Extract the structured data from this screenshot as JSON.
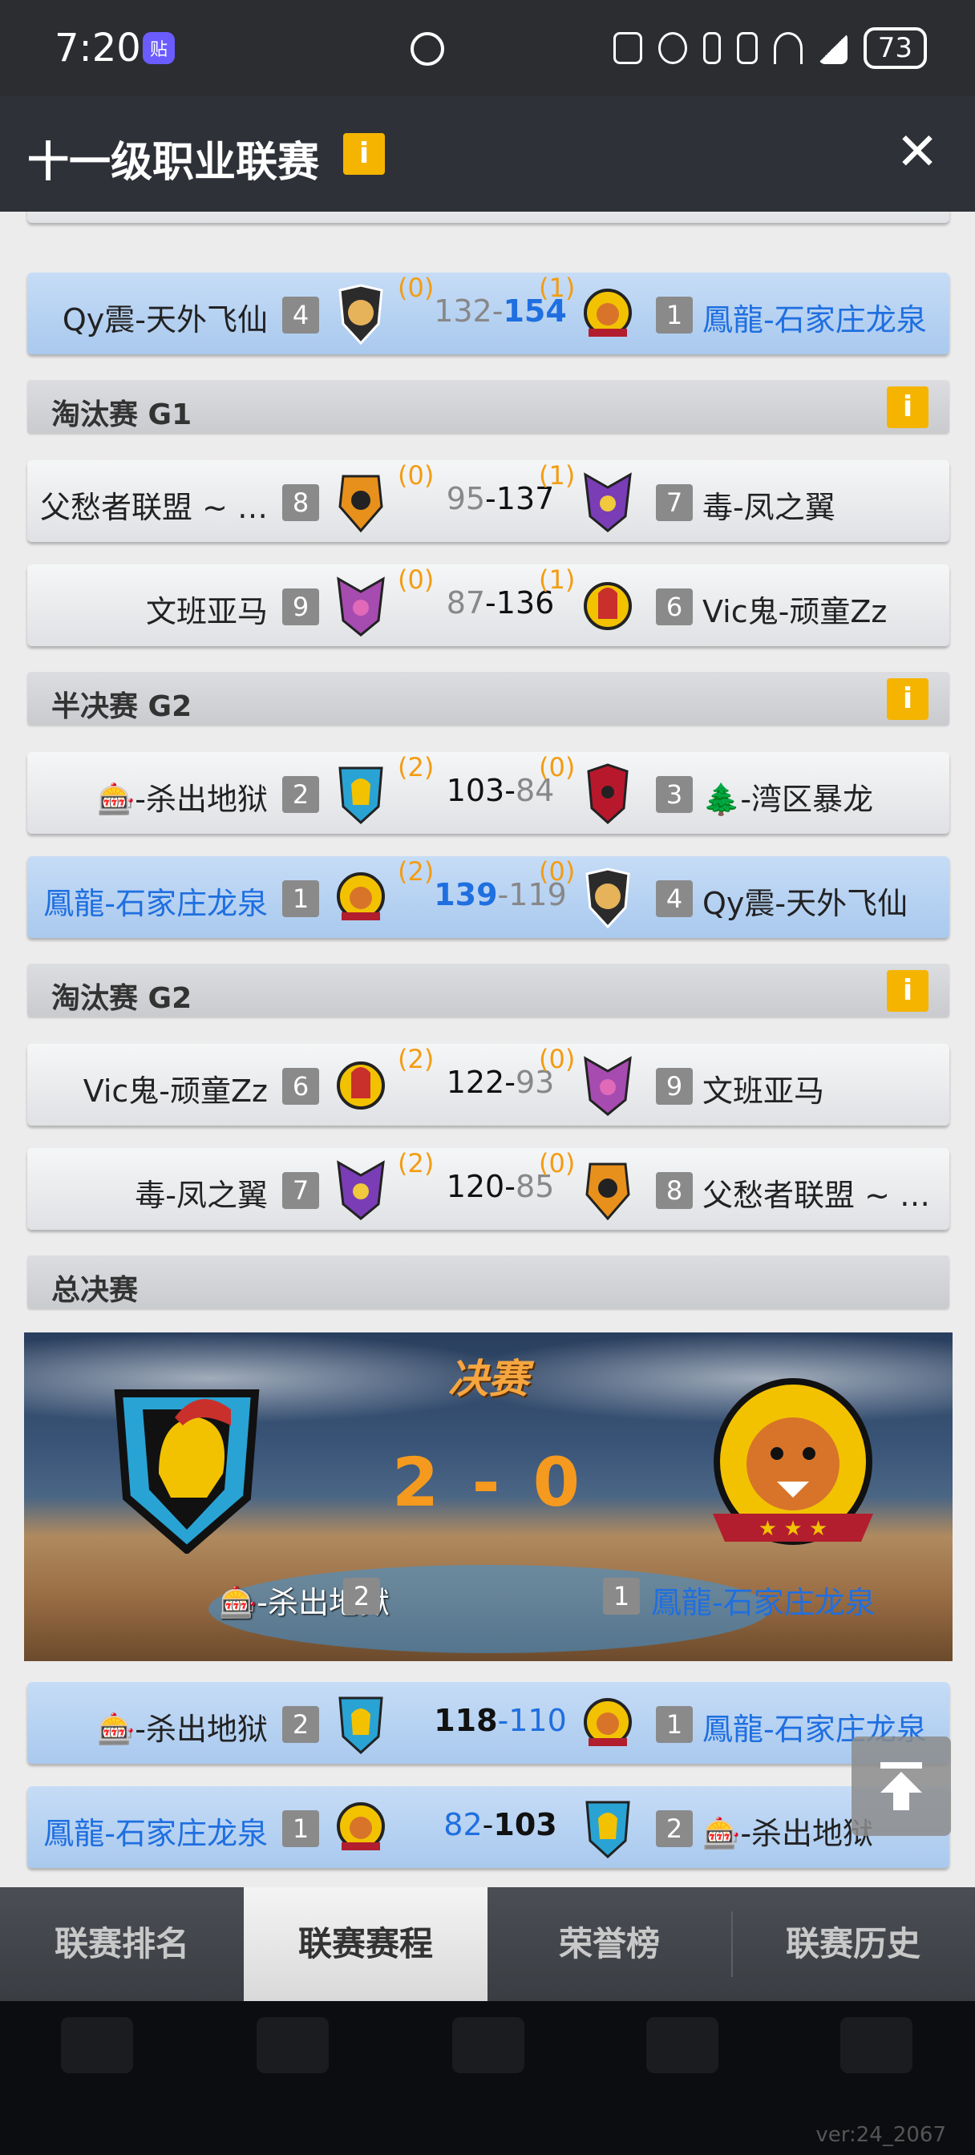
{
  "status_bar": {
    "time": "7:20",
    "app_icon": "贴",
    "battery": "73"
  },
  "header": {
    "title": "十一级职业联赛",
    "info_label": "i",
    "close_label": "✕"
  },
  "sections": {
    "elim_g1": "淘汰赛 G1",
    "semi_g2": "半决赛 G2",
    "elim_g2": "淘汰赛 G2",
    "grand_final": "总决赛",
    "info_label": "i"
  },
  "matches": [
    {
      "left_team": "Qy震-天外飞仙",
      "left_seed": "4",
      "left_series": "(0)",
      "left_score": "132",
      "right_score": "154",
      "right_series": "(1)",
      "right_seed": "1",
      "right_team": "鳳龍-石家庄龙泉"
    },
    {
      "left_team": "父愁者联盟 ~ …",
      "left_seed": "8",
      "left_series": "(0)",
      "left_score": "95",
      "right_score": "137",
      "right_series": "(1)",
      "right_seed": "7",
      "right_team": "毒-凤之翼"
    },
    {
      "left_team": "文班亚马",
      "left_seed": "9",
      "left_series": "(0)",
      "left_score": "87",
      "right_score": "136",
      "right_series": "(1)",
      "right_seed": "6",
      "right_team": "Vic鬼-顽童Zz"
    },
    {
      "left_team": "🎰-杀出地狱",
      "left_seed": "2",
      "left_series": "(2)",
      "left_score": "103",
      "right_score": "84",
      "right_series": "(0)",
      "right_seed": "3",
      "right_team": "🌲-湾区暴龙"
    },
    {
      "left_team": "鳳龍-石家庄龙泉",
      "left_seed": "1",
      "left_series": "(2)",
      "left_score": "139",
      "right_score": "119",
      "right_series": "(0)",
      "right_seed": "4",
      "right_team": "Qy震-天外飞仙"
    },
    {
      "left_team": "Vic鬼-顽童Zz",
      "left_seed": "6",
      "left_series": "(2)",
      "left_score": "122",
      "right_score": "93",
      "right_series": "(0)",
      "right_seed": "9",
      "right_team": "文班亚马"
    },
    {
      "left_team": "毒-凤之翼",
      "left_seed": "7",
      "left_series": "(2)",
      "left_score": "120",
      "right_score": "85",
      "right_series": "(0)",
      "right_seed": "8",
      "right_team": "父愁者联盟 ~ …"
    },
    {
      "left_team": "🎰-杀出地狱",
      "left_seed": "2",
      "left_score": "118",
      "right_score": "110",
      "right_seed": "1",
      "right_team": "鳳龍-石家庄龙泉"
    },
    {
      "left_team": "鳳龍-石家庄龙泉",
      "left_seed": "1",
      "left_score": "82",
      "right_score": "103",
      "right_seed": "2",
      "right_team": "🎰-杀出地狱"
    }
  ],
  "final_banner": {
    "title": "决赛",
    "score": "2 - 0",
    "left_team": "🎰-杀出地狱",
    "left_seed": "2",
    "right_seed": "1",
    "right_team": "鳳龍-石家庄龙泉"
  },
  "tabs": [
    "联赛排名",
    "联赛赛程",
    "荣誉榜",
    "联赛历史"
  ],
  "version": "ver:24_2067",
  "colors": {
    "accent_blue": "#1f6fe0",
    "series_orange": "#f39c12",
    "info_yellow": "#f4b400"
  }
}
